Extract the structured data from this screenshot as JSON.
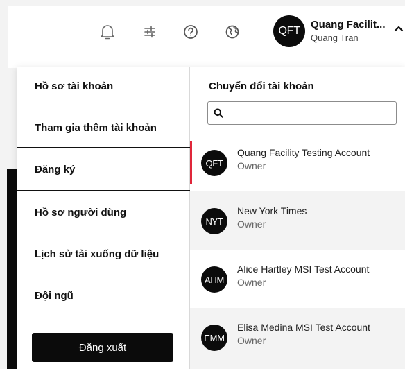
{
  "header": {
    "icons": [
      "bell-icon",
      "sliders-icon",
      "help-circle-icon",
      "globe-icon"
    ],
    "current_account": {
      "initials": "QFT",
      "name": "Quang Facilit...",
      "user": "Quang Tran"
    }
  },
  "menu": {
    "items": [
      {
        "label": "Hồ sơ tài khoản"
      },
      {
        "label": "Tham gia thêm tài khoản"
      },
      {
        "label": "Đăng ký"
      },
      {
        "label": "Hồ sơ người dùng"
      },
      {
        "label": "Lịch sử tải xuống dữ liệu"
      },
      {
        "label": "Đội ngũ"
      }
    ],
    "active_index": 2,
    "logout_label": "Đăng xuất"
  },
  "switcher": {
    "title": "Chuyển đổi tài khoản",
    "search_value": "",
    "accounts": [
      {
        "initials": "QFT",
        "name": "Quang Facility Testing Account",
        "role": "Owner",
        "current": true
      },
      {
        "initials": "NYT",
        "name": "New York Times",
        "role": "Owner",
        "current": false
      },
      {
        "initials": "AHM",
        "name": "Alice Hartley MSI Test Account",
        "role": "Owner",
        "current": false
      },
      {
        "initials": "EMM",
        "name": "Elisa Medina MSI Test Account",
        "role": "Owner",
        "current": false
      }
    ]
  },
  "colors": {
    "accent_current": "#e0263a",
    "avatar_bg": "#0b0b0b",
    "row_alt_bg": "#f3f3f3"
  }
}
